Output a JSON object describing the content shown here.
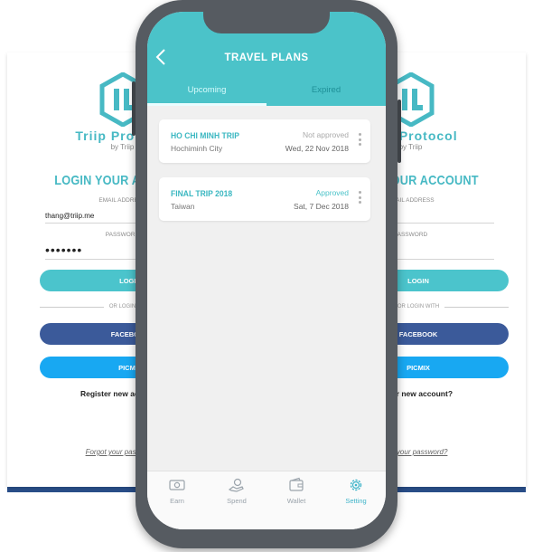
{
  "background_login": {
    "brand": "Triip Protocol",
    "byline": "by Triip",
    "title": "LOGIN YOUR ACCOUNT",
    "email_label": "EMAIL ADDRESS",
    "email_value": "thang@triip.me",
    "password_label": "PASSWORD",
    "password_value": "•••••••",
    "login_button": "LOGIN",
    "or_login_with": "OR LOGIN WITH",
    "facebook_button": "FACEBOOK",
    "picmix_button": "PICMIX",
    "register_link": "Register new account?",
    "forgot_link": "Forgot your password?"
  },
  "app": {
    "title": "TRAVEL PLANS",
    "tabs": [
      "Upcoming",
      "Expired"
    ],
    "active_tab": "Upcoming",
    "trips": [
      {
        "name": "HO CHI MINH TRIP",
        "city": "Hochiminh City",
        "status": "Not approved",
        "date": "Wed, 22 Nov 2018"
      },
      {
        "name": "FINAL TRIP 2018",
        "city": "Taiwan",
        "status": "Approved",
        "date": "Sat, 7 Dec 2018"
      }
    ],
    "nav": [
      {
        "label": "Earn",
        "icon": "earn-icon"
      },
      {
        "label": "Spend",
        "icon": "spend-icon"
      },
      {
        "label": "Wallet",
        "icon": "wallet-icon"
      },
      {
        "label": "Setting",
        "icon": "gear-icon"
      }
    ],
    "active_nav": "Setting"
  },
  "colors": {
    "teal": "#4bc3c9",
    "facebook": "#3b5a9a",
    "picmix": "#18a8f2",
    "phone_frame": "#565b61"
  }
}
